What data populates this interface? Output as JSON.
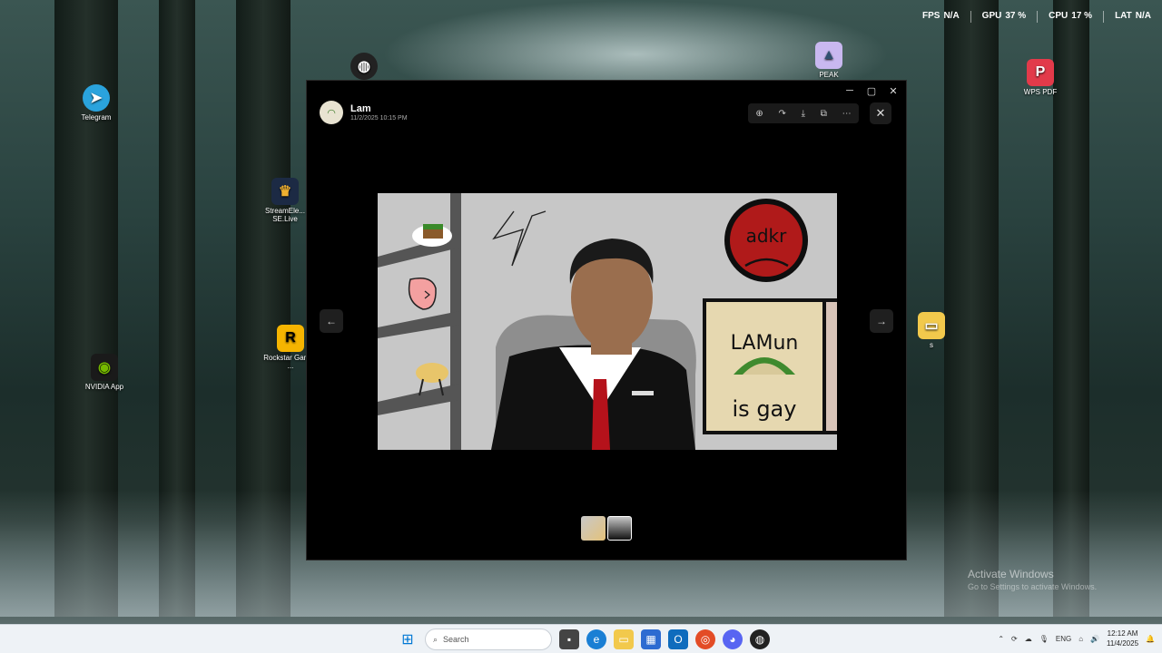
{
  "perf": {
    "fps_label": "FPS",
    "fps_value": "N/A",
    "gpu_label": "GPU",
    "gpu_value": "37 %",
    "cpu_label": "CPU",
    "cpu_value": "17 %",
    "lat_label": "LAT",
    "lat_value": "N/A"
  },
  "desktop": {
    "telegram": "Telegram",
    "streamelements": "StreamEle... SE.Live",
    "rockstar": "Rockstar Games ...",
    "nvidia": "NVIDIA App",
    "peak": "PEAK",
    "wps": "WPS PDF",
    "folder": "s"
  },
  "viewer": {
    "user_name": "Lam",
    "timestamp": "11/2/2025 10:15 PM",
    "prev_label": "←",
    "next_label": "→",
    "close_label": "✕",
    "drawing": {
      "sign_top": "adkr",
      "poster_top": "LAMun",
      "poster_bottom": "is gay"
    }
  },
  "activate": {
    "title": "Activate Windows",
    "subtitle": "Go to Settings to activate Windows."
  },
  "taskbar": {
    "search_placeholder": "Search",
    "lang": "ENG",
    "time": "12:12 AM",
    "date": "11/4/2025"
  },
  "colors": {
    "accent": "#5865f2",
    "tie": "#b5121b",
    "sign_red": "#b01a1a",
    "poster_bg": "#e6d8b0"
  }
}
